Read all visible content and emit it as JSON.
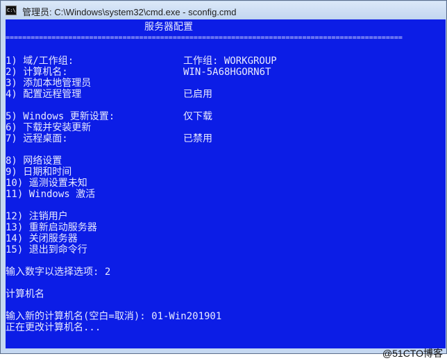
{
  "window": {
    "title": "管理员: C:\\Windows\\system32\\cmd.exe - sconfig.cmd",
    "icon": "cmd-icon"
  },
  "console": {
    "header": "服务器配置",
    "separator": "===============================================================================================",
    "menu": [
      {
        "label": "1) 域/工作组:",
        "value": "工作组:  WORKGROUP"
      },
      {
        "label": "2) 计算机名:",
        "value": "WIN-5A68HGORN6T"
      },
      {
        "label": "3) 添加本地管理员",
        "value": ""
      },
      {
        "label": "4) 配置远程管理",
        "value": "已启用"
      },
      {
        "label": "5) Windows 更新设置:",
        "value": "仅下载"
      },
      {
        "label": "6) 下载并安装更新",
        "value": ""
      },
      {
        "label": "7) 远程桌面:",
        "value": "已禁用"
      },
      {
        "label": "8) 网络设置",
        "value": ""
      },
      {
        "label": "9) 日期和时间",
        "value": ""
      },
      {
        "label": "10) 遥测设置未知",
        "value": ""
      },
      {
        "label": "11) Windows 激活",
        "value": ""
      },
      {
        "label": "12) 注销用户",
        "value": ""
      },
      {
        "label": "13) 重新启动服务器",
        "value": ""
      },
      {
        "label": "14) 关闭服务器",
        "value": ""
      },
      {
        "label": "15) 退出到命令行",
        "value": ""
      }
    ],
    "prompt": "输入数字以选择选项: 2",
    "section_title": "计算机名",
    "input_prompt": "输入新的计算机名(空白=取消): 01-Win201901",
    "status": "正在更改计算机名..."
  },
  "watermark": "@51CTO博客",
  "colors": {
    "console_background": "#0c1de6",
    "console_text": "#e8eaff",
    "titlebar": "#c9dbf2"
  }
}
